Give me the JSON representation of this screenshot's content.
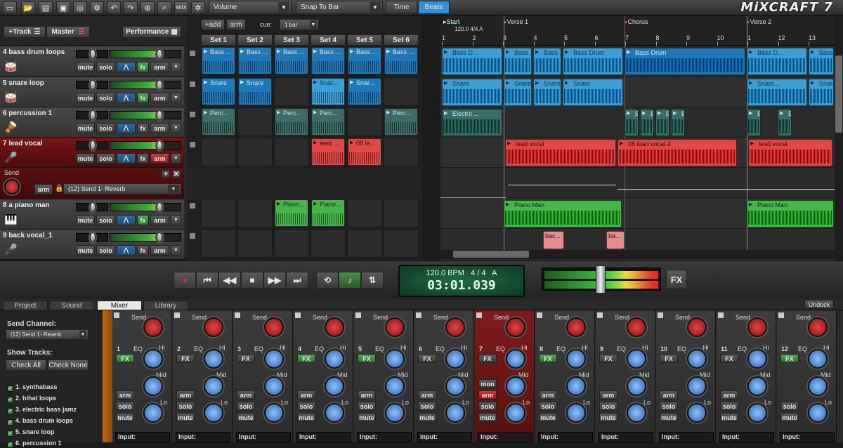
{
  "toolbar": {
    "volume_label": "Volume",
    "snap_label": "Snap To Bar",
    "time_tab": "Time",
    "beats_tab": "Beats",
    "logo_text": "MiXCRAFT 7",
    "icons": [
      "new-icon",
      "open-icon",
      "open-project-icon",
      "save-icon",
      "record-settings-icon",
      "settings-icon",
      "undo-icon",
      "redo-icon",
      "add-track-icon",
      "search-icon",
      "midi-icon",
      "gear-icon"
    ]
  },
  "tracks_header": {
    "add_track": "+Track",
    "master": "Master",
    "performance": "Performance"
  },
  "tracks": [
    {
      "name": "4 bass drum loops",
      "mute": "mute",
      "solo": "solo",
      "fx": "fx",
      "arm": "arm"
    },
    {
      "name": "5 snare loop",
      "mute": "mute",
      "solo": "solo",
      "fx": "fx",
      "arm": "arm"
    },
    {
      "name": "6 percussion 1",
      "mute": "mute",
      "solo": "solo",
      "fx": "fx",
      "arm": "arm"
    },
    {
      "name": "7 lead vocal",
      "mute": "mute",
      "solo": "solo",
      "fx": "fx",
      "arm": "arm"
    },
    {
      "name": "8 a piano man",
      "mute": "mute",
      "solo": "solo",
      "fx": "fx",
      "arm": "arm"
    },
    {
      "name": "9 back vocal_1",
      "mute": "mute",
      "solo": "solo",
      "fx": "fx",
      "arm": "arm"
    }
  ],
  "send": {
    "label": "Send",
    "arm": "arm",
    "target": "(12) Send 1- Reverb"
  },
  "grid": {
    "add": "+add",
    "arm": "arm",
    "cue_label": "cue:",
    "cue_value": "1 bar",
    "sets": [
      "Set 1",
      "Set 2",
      "Set 3",
      "Set 4",
      "Set 5",
      "Set 6"
    ],
    "clips": {
      "bass": "Bass ...",
      "snare": "Snare",
      "snare_short": "Snar...",
      "perc": "Perc...",
      "lead": "lead ...",
      "lead2": "08 le...",
      "piano": "Piano..."
    }
  },
  "timeline": {
    "markers": {
      "start": "Start",
      "tempo": "120.0 4/4 A",
      "verse1": "Verse 1",
      "chorus": "Chorus",
      "verse2": "Verse 2"
    },
    "ruler_numbers": [
      "1",
      "2",
      "3",
      "4",
      "5",
      "6",
      "7",
      "8",
      "9",
      "10",
      "1",
      "12",
      "13"
    ],
    "clips": {
      "bass_d": "Bass D...",
      "bass": "Bass ...",
      "bass_drum": "Bass Drum",
      "snare": "Snare",
      "snare_short": "Snare...",
      "electro": "Electro ...",
      "el": "El...",
      "lead_vocal": "lead vocal",
      "lead_vocal2": "08 lead vocal-2",
      "piano_man": "Piano Man",
      "bac": "bac...",
      "ba": "ba..."
    }
  },
  "transport": {
    "tempo": "120.0 BPM",
    "sig": "4 / 4",
    "key": "A",
    "time": "03:01.039",
    "fx": "FX"
  },
  "tabs": [
    "Project",
    "Sound",
    "Mixer",
    "Library"
  ],
  "undock": "Undock",
  "mixer_left": {
    "send_channel_label": "Send Channel:",
    "send_channel_value": "(12) Send 1- Reverb",
    "show_tracks": "Show Tracks:",
    "check_all": "Check All",
    "check_none": "Check None",
    "items": [
      "1. synthabass",
      "2. hihat loops",
      "3. electric bass jamz",
      "4. bass drum loops",
      "5. snare loop",
      "6. percussion 1"
    ]
  },
  "mixer": {
    "send": "Send",
    "eq": "EQ",
    "hi": "Hi",
    "mid": "Mid",
    "lo": "Lo",
    "fx": "FX",
    "arm": "arm",
    "solo": "solo",
    "mute": "mute",
    "mon": "mon",
    "input": "Input:",
    "channels": [
      "1",
      "2",
      "3",
      "4",
      "5",
      "6",
      "7",
      "8",
      "9",
      "10",
      "11",
      "12"
    ]
  }
}
